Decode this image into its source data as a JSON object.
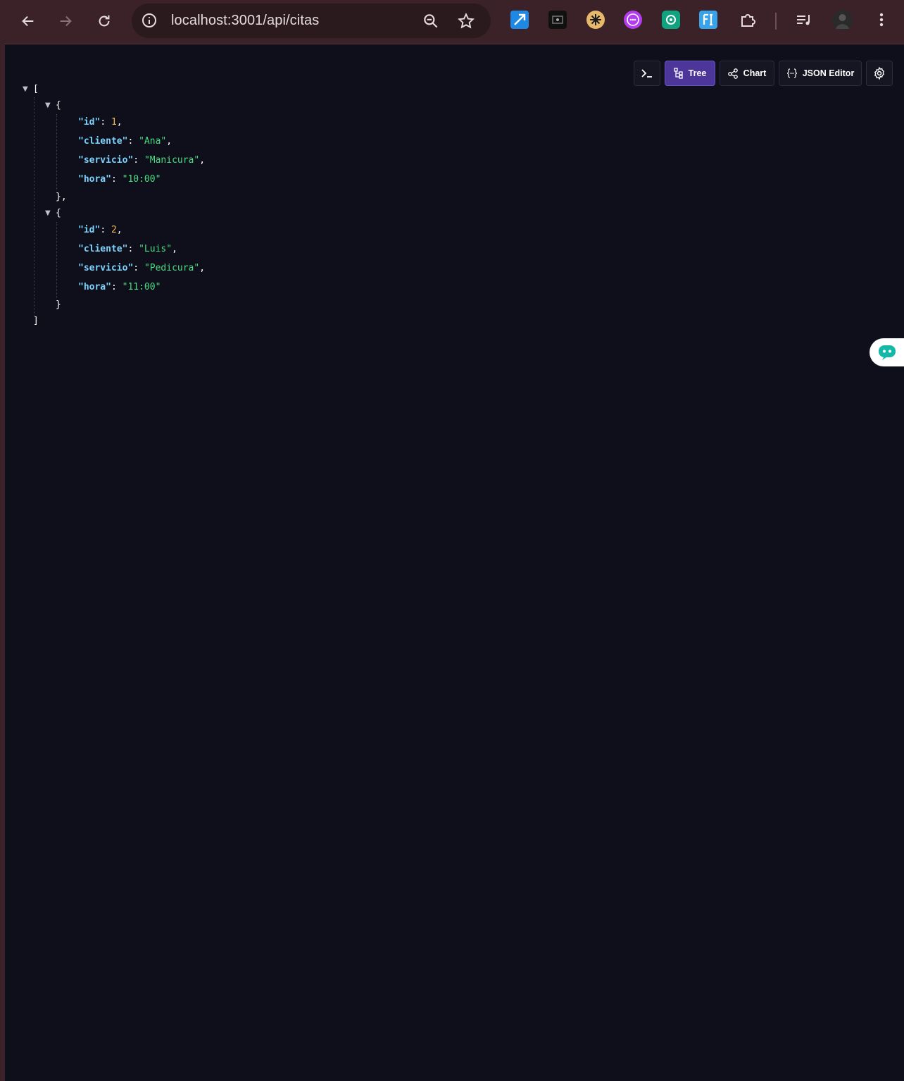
{
  "browser": {
    "url": "localhost:3001/api/citas"
  },
  "toolbar": {
    "tree_label": "Tree",
    "chart_label": "Chart",
    "json_editor_label": "JSON Editor"
  },
  "json": {
    "open_bracket": "[",
    "close_bracket": "]",
    "items": [
      {
        "id": "1",
        "cliente": "\"Ana\"",
        "servicio": "\"Manicura\"",
        "hora": "\"10:00\""
      },
      {
        "id": "2",
        "cliente": "\"Luis\"",
        "servicio": "\"Pedicura\"",
        "hora": "\"11:00\""
      }
    ],
    "keys": {
      "id": "\"id\"",
      "cliente": "\"cliente\"",
      "servicio": "\"servicio\"",
      "hora": "\"hora\""
    }
  },
  "colors": {
    "chrome": "#3b2228",
    "page_bg": "#0f0f1c",
    "key": "#7dd3fc",
    "number": "#f5b94c",
    "string": "#4ade80",
    "active_tab": "#4c3699"
  }
}
